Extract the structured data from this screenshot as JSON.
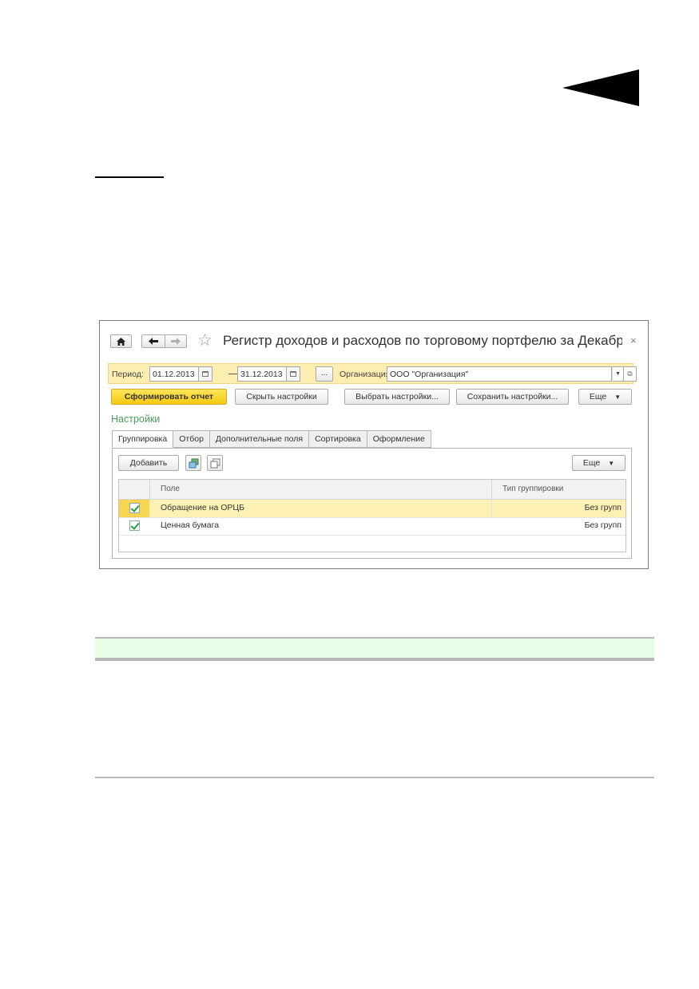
{
  "window": {
    "title": "Регистр доходов и расходов по торговому портфелю за Декабр...",
    "close_label": "×",
    "nav": {
      "home_icon": "home-icon",
      "back_icon": "arrow-left-icon",
      "forward_icon": "arrow-right-icon",
      "favorite_icon": "star-icon"
    }
  },
  "period_bar": {
    "period_label": "Период:",
    "date_from": "01.12.2013",
    "dash": "—",
    "date_to": "31.12.2013",
    "choose_period": "...",
    "org_label": "Организация:",
    "org_value": "ООО \"Организация\""
  },
  "toolbar": {
    "generate": "Сформировать отчет",
    "hide_settings": "Скрыть настройки",
    "choose_settings": "Выбрать настройки...",
    "save_settings": "Сохранить настройки...",
    "more": "Еще"
  },
  "settings": {
    "title": "Настройки",
    "tabs": [
      {
        "label": "Группировка",
        "active": true
      },
      {
        "label": "Отбор"
      },
      {
        "label": "Дополнительные поля"
      },
      {
        "label": "Сортировка"
      },
      {
        "label": "Оформление"
      }
    ],
    "panel_toolbar": {
      "add": "Добавить",
      "more": "Еще",
      "group_icon": "group-icon",
      "copy_icon": "copy-icon"
    },
    "grid": {
      "columns": [
        "Поле",
        "Тип группировки"
      ],
      "rows": [
        {
          "checked": true,
          "field": "Обращение на ОРЦБ",
          "type": "Без групп",
          "selected": true
        },
        {
          "checked": true,
          "field": "Ценная бумага",
          "type": "Без групп",
          "selected": false
        }
      ]
    }
  },
  "colors": {
    "accent_yellow": "#f5c90f",
    "highlight": "#fbeeb0",
    "settings_green": "#4a9a5b",
    "band_green": "#e8fde6"
  }
}
